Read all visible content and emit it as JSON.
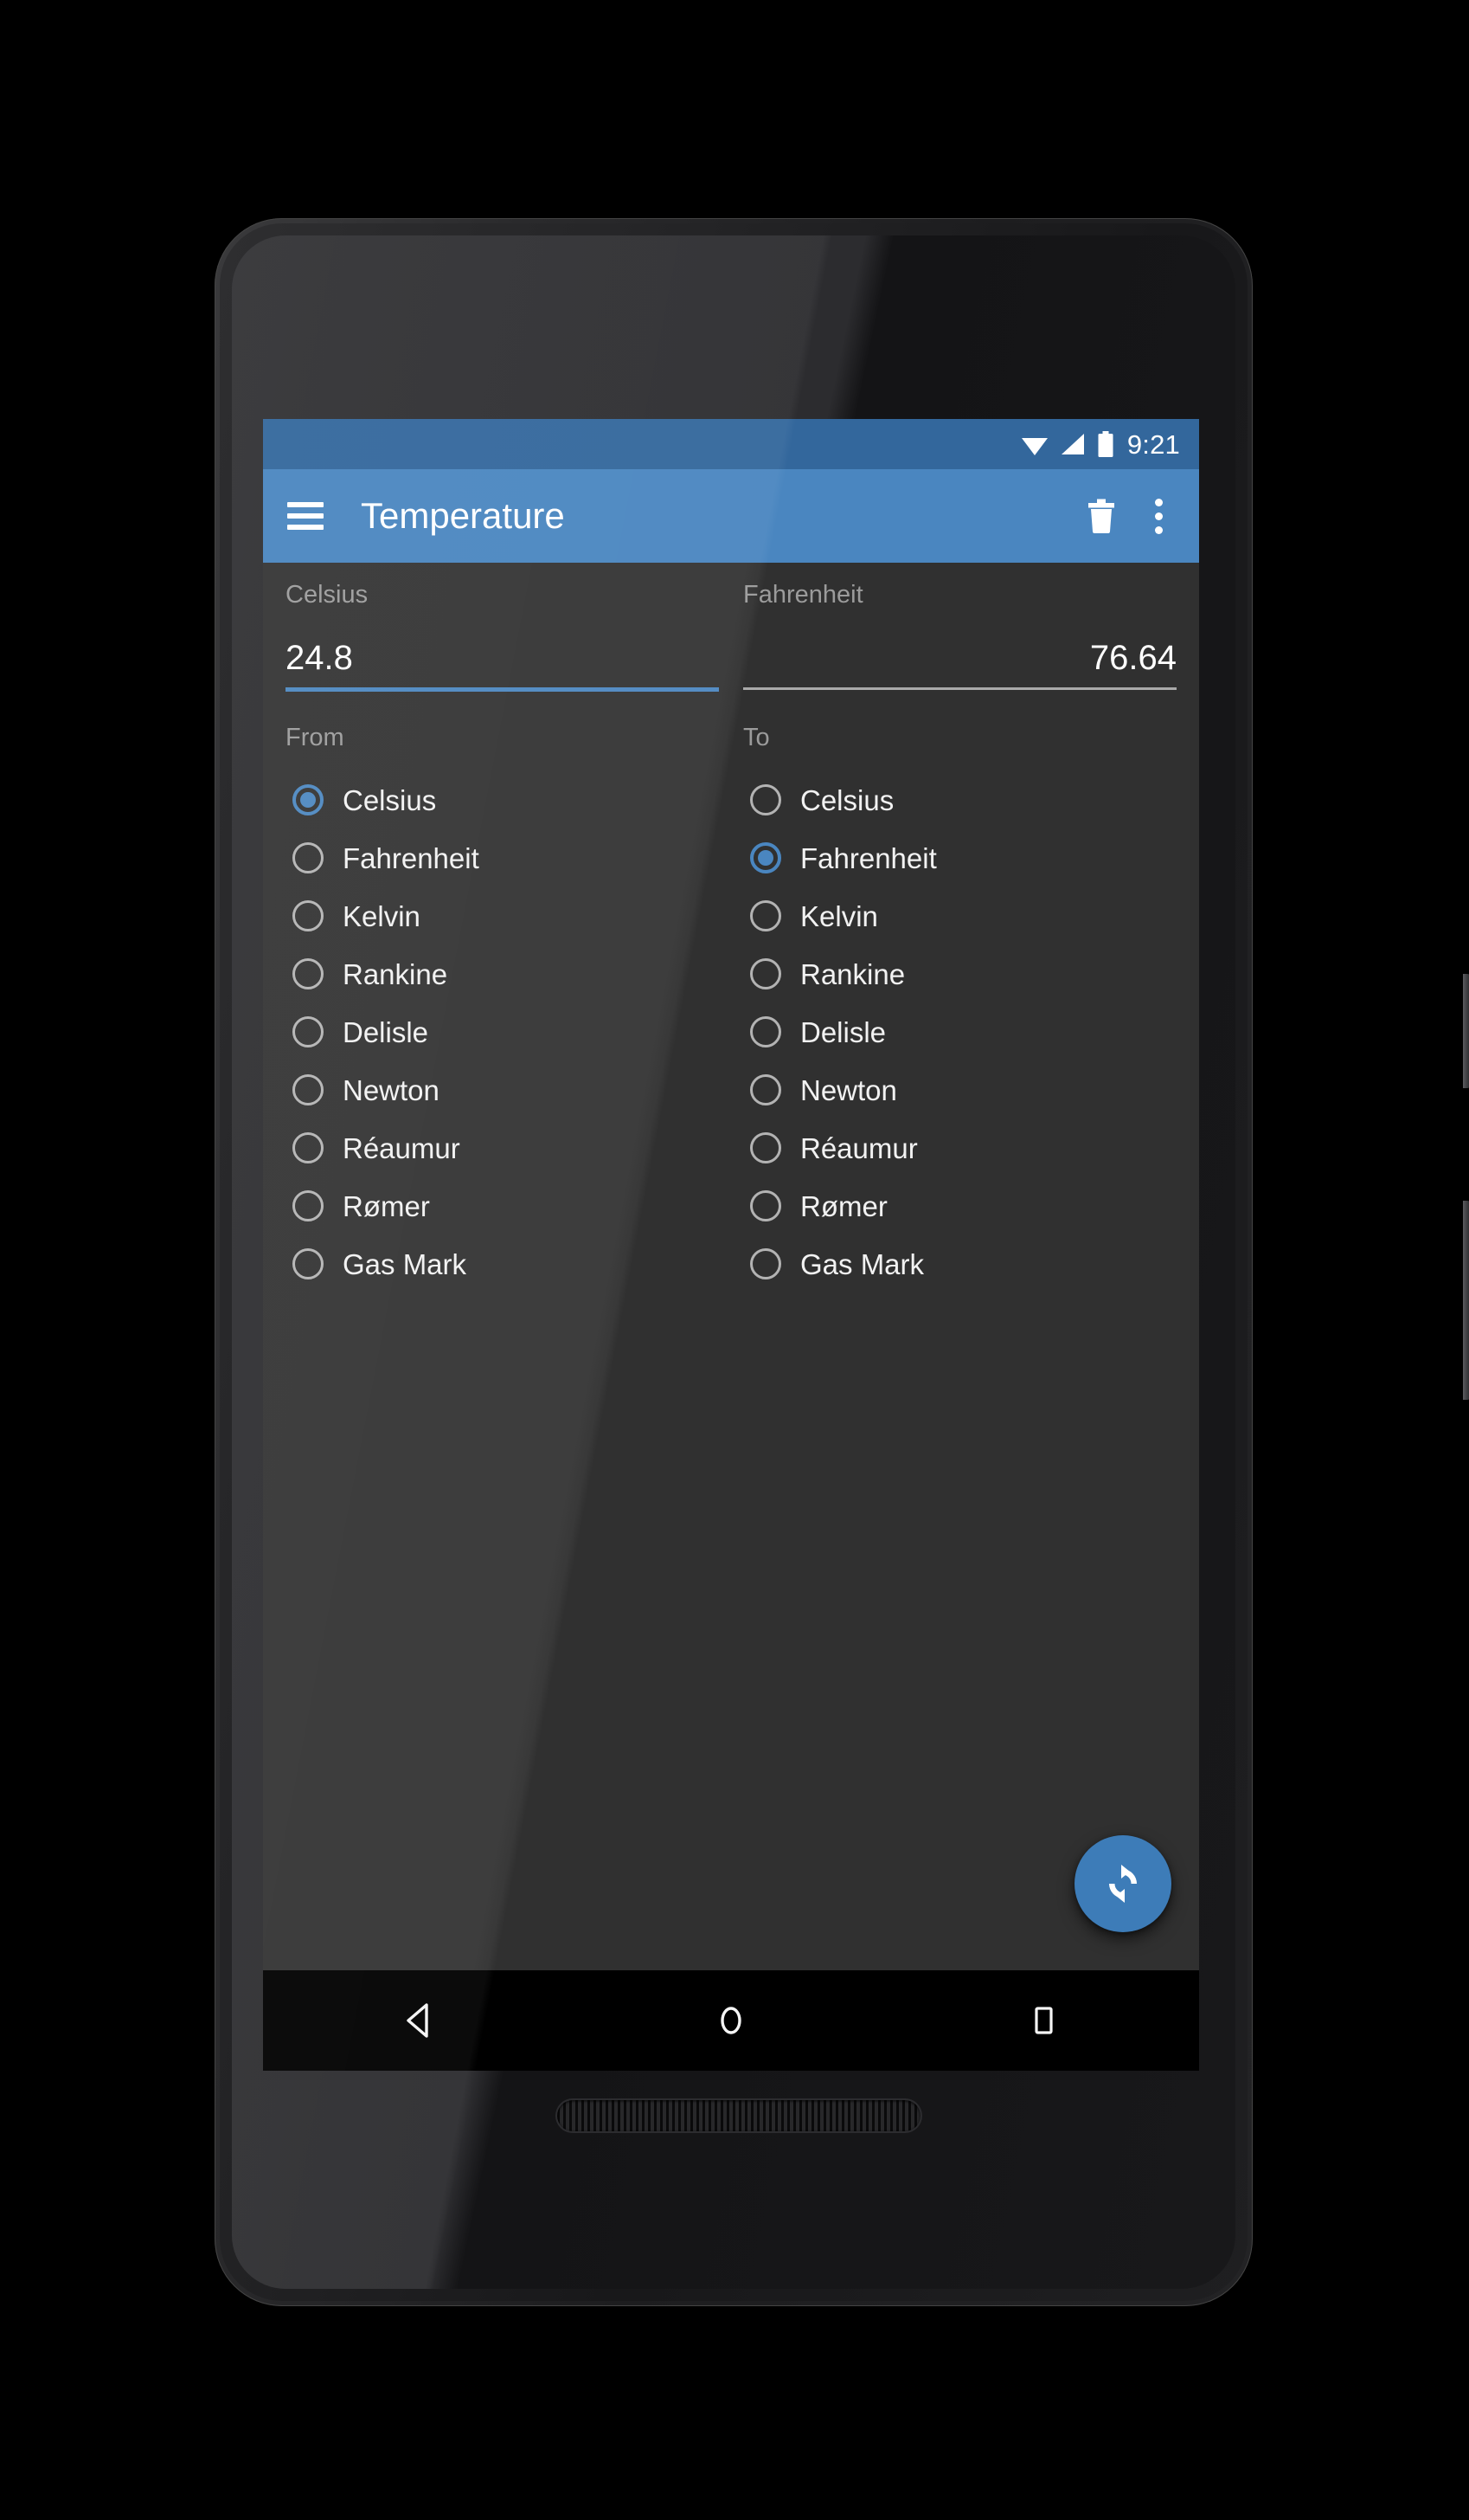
{
  "status_bar": {
    "time": "9:21",
    "icons": [
      "wifi-icon",
      "cell-signal-icon",
      "battery-icon"
    ]
  },
  "app_bar": {
    "menu_icon": "hamburger-menu-icon",
    "title": "Temperature",
    "actions": [
      {
        "icon": "trash-icon",
        "name": "delete-button"
      },
      {
        "icon": "overflow-menu-icon",
        "name": "overflow-menu-button"
      }
    ]
  },
  "converter": {
    "input": {
      "unit_label": "Celsius",
      "value": "24.8"
    },
    "output": {
      "unit_label": "Fahrenheit",
      "value": "76.64"
    },
    "from_label": "From",
    "to_label": "To",
    "units": [
      "Celsius",
      "Fahrenheit",
      "Kelvin",
      "Rankine",
      "Delisle",
      "Newton",
      "Réaumur",
      "Rømer",
      "Gas Mark"
    ],
    "from_selected": "Celsius",
    "to_selected": "Fahrenheit"
  },
  "fab": {
    "icon": "refresh-swap-icon",
    "name": "swap-units-button"
  },
  "nav_bar": {
    "back": "back-triangle-icon",
    "home": "home-circle-icon",
    "recents": "recents-square-icon"
  },
  "colors": {
    "accent": "#4a86c0",
    "status_bar": "#33679c",
    "app_bar": "#4a86c0",
    "content_bg": "#303030",
    "fab": "#3d7cb8",
    "radio_unchecked": "#b3b3b3",
    "label_text": "#9b9b9b"
  }
}
